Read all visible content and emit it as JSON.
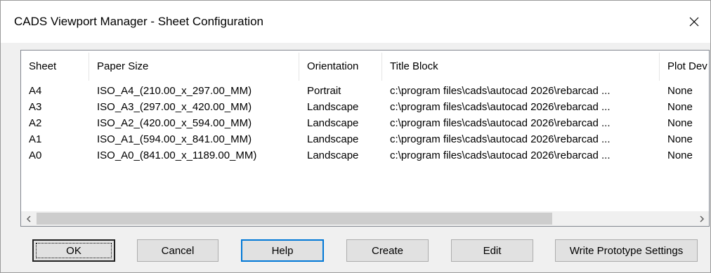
{
  "window": {
    "title": "CADS Viewport Manager - Sheet Configuration",
    "close_icon": "close-icon"
  },
  "table": {
    "columns": [
      "Sheet",
      "Paper Size",
      "Orientation",
      "Title Block",
      "Plot Dev"
    ],
    "rows": [
      [
        "A4",
        "ISO_A4_(210.00_x_297.00_MM)",
        "Portrait",
        "c:\\program files\\cads\\autocad 2026\\rebarcad ...",
        "None"
      ],
      [
        "A3",
        "ISO_A3_(297.00_x_420.00_MM)",
        "Landscape",
        "c:\\program files\\cads\\autocad 2026\\rebarcad ...",
        "None"
      ],
      [
        "A2",
        "ISO_A2_(420.00_x_594.00_MM)",
        "Landscape",
        "c:\\program files\\cads\\autocad 2026\\rebarcad ...",
        "None"
      ],
      [
        "A1",
        "ISO_A1_(594.00_x_841.00_MM)",
        "Landscape",
        "c:\\program files\\cads\\autocad 2026\\rebarcad ...",
        "None"
      ],
      [
        "A0",
        "ISO_A0_(841.00_x_1189.00_MM)",
        "Landscape",
        "c:\\program files\\cads\\autocad 2026\\rebarcad ...",
        "None"
      ]
    ]
  },
  "scrollbar": {
    "left_icon": "chevron-left-icon",
    "right_icon": "chevron-right-icon"
  },
  "buttons": {
    "ok": "OK",
    "cancel": "Cancel",
    "help": "Help",
    "create": "Create",
    "edit": "Edit",
    "write_prototype": "Write Prototype Settings"
  },
  "colors": {
    "focus_border": "#0078d7",
    "dialog_bg": "#f0f0f0",
    "scroll_thumb": "#cdcdcd"
  }
}
